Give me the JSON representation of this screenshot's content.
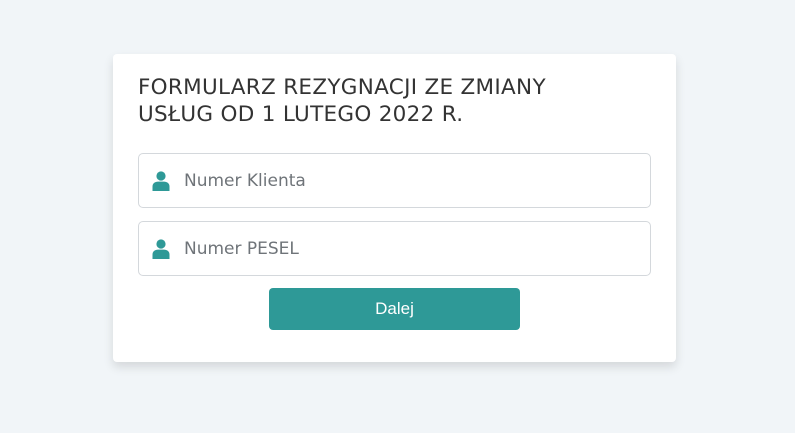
{
  "form": {
    "title_line1": "FORMULARZ REZYGNACJI ZE ZMIANY",
    "title_line2": "USŁUG OD 1 LUTEGO 2022 R.",
    "fields": [
      {
        "placeholder": "Numer Klienta",
        "value": "",
        "icon": "user-icon"
      },
      {
        "placeholder": "Numer PESEL",
        "value": "",
        "icon": "user-icon"
      }
    ],
    "submit_label": "Dalej"
  },
  "colors": {
    "background": "#f1f5f8",
    "accent": "#2e9997",
    "text": "#333333"
  }
}
